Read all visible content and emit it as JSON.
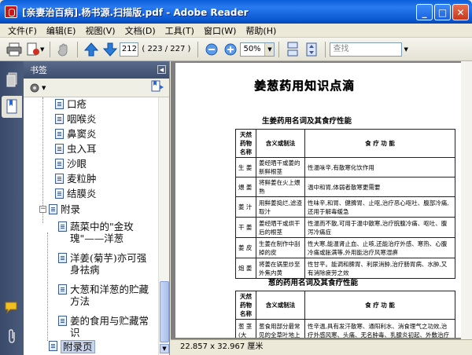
{
  "window": {
    "title": "[亲妻治百病].杨书源.扫描版.pdf - Adobe Reader",
    "minimize": "_",
    "maximize": "□",
    "close": "✕"
  },
  "menu": [
    "文件(F)",
    "编辑(E)",
    "视图(V)",
    "文档(D)",
    "工具(T)",
    "窗口(W)",
    "帮助(H)"
  ],
  "toolbar": {
    "current_page": "212",
    "page_total": "( 223 / 227 )",
    "zoom": "50%",
    "search_placeholder": "查找"
  },
  "bookmarks": {
    "header": "书签",
    "items": [
      {
        "label": "口疮",
        "indent": 1
      },
      {
        "label": "咽喉炎",
        "indent": 1
      },
      {
        "label": "鼻窦炎",
        "indent": 1
      },
      {
        "label": "虫入耳",
        "indent": 1
      },
      {
        "label": "沙眼",
        "indent": 1
      },
      {
        "label": "麦粒肿",
        "indent": 1
      },
      {
        "label": "结膜炎",
        "indent": 1
      },
      {
        "label": "附录",
        "indent": 0
      },
      {
        "label": "蔬菜中的\"金玫瑰\"——洋葱",
        "indent": 1
      },
      {
        "label": "洋姜(菊芋)亦可强身祛病",
        "indent": 1
      },
      {
        "label": "大葱和洋葱的贮藏方法",
        "indent": 1
      },
      {
        "label": "姜的食用与贮藏常识",
        "indent": 1
      },
      {
        "label": "附录页",
        "indent": 0
      }
    ]
  },
  "status": {
    "page_size": "22.857 x 32.967 厘米"
  },
  "page": {
    "title": "姜葱药用知识点滴",
    "table1": {
      "caption": "生姜药用名词及其食疗性能",
      "headers": [
        "天然药物名称",
        "含义或制法",
        "食 疗 功 能"
      ],
      "rows": [
        [
          "生 姜",
          "姜经晒干或姜的新鲜根茎",
          "性温味辛,有散寒化饮作用"
        ],
        [
          "煨 姜",
          "将鲜姜在火上煨熟",
          "温中和胃,体弱者散寒更需要"
        ],
        [
          "姜 汁",
          "用鲜姜捣烂,滤渣取汁",
          "性味辛,和胃、健脾胃、止呕,治疗恶心呕吐、腹部冷痛,还用于解毒缓急"
        ],
        [
          "干 姜",
          "姜经晒干或烘干后的根茎",
          "性温而不散,可用于温中散寒,治疗脘腹冷痛、呕吐、腹泻冷痛症"
        ],
        [
          "姜 皮",
          "生姜在制作中刮掉的皮",
          "性大寒,能温肾止血、止咳,还能治疗外感、寒热、心腹冷痛或胀满等,外用能治疗风寒湿痹"
        ],
        [
          "炮 姜",
          "将姜在锅里炒至外焦内黄",
          "性甘平。能调和脾胃、利尿消肿,治疗肠胃病、水肿,又有消除疲劳之效"
        ]
      ]
    },
    "table2": {
      "caption": "葱的药用名词及其食疗性能",
      "headers": [
        "天然药物名称",
        "含义或制法",
        "食 疗 功 能"
      ],
      "rows": [
        [
          "葱 茎 (大葱)",
          "葱食用部分最常见的全草叶地上部",
          "性辛温,具有发汗散寒、通阳利水、消食理气之功效,治疗外感风寒、头痛、无名肿毒、乳腺炎初起、外敷治疗冻疮、疔疮、痈疖"
        ]
      ]
    }
  }
}
